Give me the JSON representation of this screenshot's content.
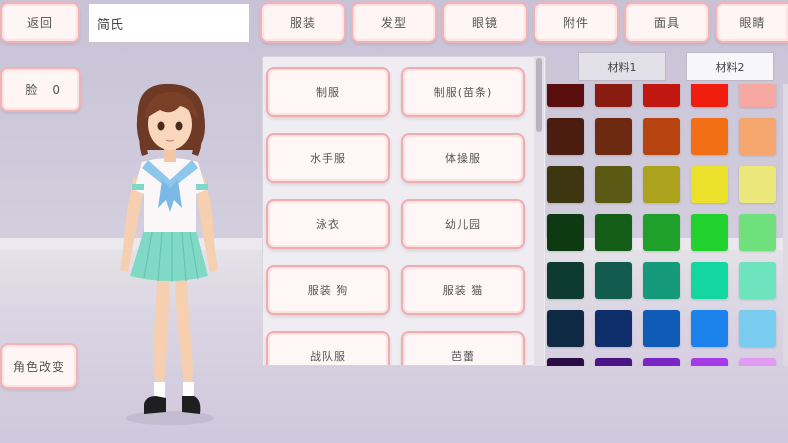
{
  "top_bar": {
    "back_label": "返回",
    "name_value": "简氏",
    "categories": [
      "服装",
      "发型",
      "眼镜",
      "附件",
      "面具",
      "眼睛"
    ]
  },
  "left": {
    "face_label": "脸",
    "face_value": "0",
    "change_character_label": "角色改变"
  },
  "outfits": [
    "制服",
    "制服(苗条)",
    "水手服",
    "体操服",
    "泳衣",
    "幼儿园",
    "服装 狗",
    "服装 猫",
    "战队服",
    "芭蕾"
  ],
  "materials": {
    "tab1": "材料1",
    "tab2": "材料2"
  },
  "palette": {
    "rows": [
      [
        "#5a0d0d",
        "#8a1b10",
        "#c01810",
        "#f01e0f",
        "#f7a8a0"
      ],
      [
        "#4a1d10",
        "#6e2a10",
        "#b7430f",
        "#f26f15",
        "#f5a56e"
      ],
      [
        "#3e3610",
        "#5b5a14",
        "#aca21b",
        "#ece12a",
        "#ebe77b"
      ],
      [
        "#0e3a12",
        "#145d18",
        "#1fa02a",
        "#21d12e",
        "#6fe07c"
      ],
      [
        "#0d3b33",
        "#135a4f",
        "#14997a",
        "#14d6a0",
        "#6de4bd"
      ],
      [
        "#0e2a45",
        "#0f2f6a",
        "#0f5bb5",
        "#1a82ea",
        "#79cbf0"
      ],
      [
        "#2b0e45",
        "#4a1584",
        "#7a26c5",
        "#a63be8",
        "#e19cf1"
      ]
    ]
  },
  "colors": {
    "button_border": "#f2b3b7",
    "button_fill": "#fff5f5",
    "tab_active": "#e2e0e8",
    "tab_inactive": "#f7f6f9"
  }
}
